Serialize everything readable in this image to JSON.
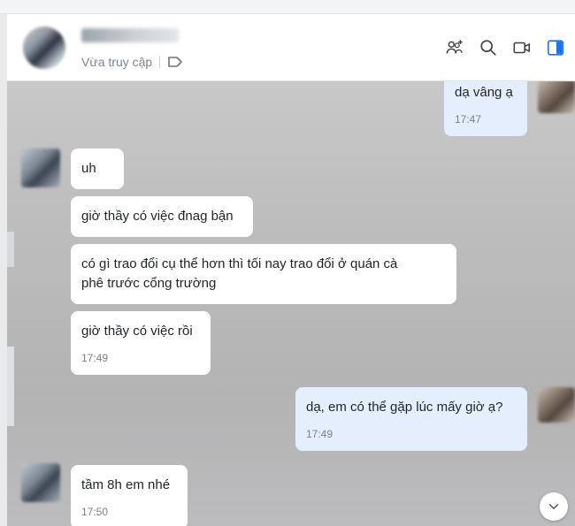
{
  "header": {
    "status": "Vừa truy cập"
  },
  "messages": [
    {
      "id": "m1",
      "text": "dạ vâng ạ",
      "time": "17:47",
      "direction": "out"
    },
    {
      "id": "m2",
      "text": "uh",
      "time": "",
      "direction": "in"
    },
    {
      "id": "m3",
      "text": "giờ thầy có việc đnag bận",
      "time": "",
      "direction": "in"
    },
    {
      "id": "m4",
      "text": "có gì trao đổi cụ thể hơn thì tối nay  trao đổi ở quán cà phê trước cổng trường",
      "time": "",
      "direction": "in"
    },
    {
      "id": "m5",
      "text": "giờ thầy có việc rồi",
      "time": "17:49",
      "direction": "in"
    },
    {
      "id": "m6",
      "text": "dạ,  em có thể gặp lúc mấy giờ ạ?",
      "time": "17:49",
      "direction": "out"
    },
    {
      "id": "m7",
      "text": "tầm 8h em nhé",
      "time": "17:50",
      "direction": "in"
    }
  ],
  "icons": {
    "add_member": "add-member-icon",
    "search": "search-icon",
    "video": "video-call-icon",
    "sidebar": "sidebar-toggle-icon",
    "tag": "tag-icon",
    "scroll": "chevron-down-icon"
  },
  "colors": {
    "accent": "#1a73e8",
    "outgoing_bubble": "#e5eefc",
    "incoming_bubble": "#ffffff"
  }
}
